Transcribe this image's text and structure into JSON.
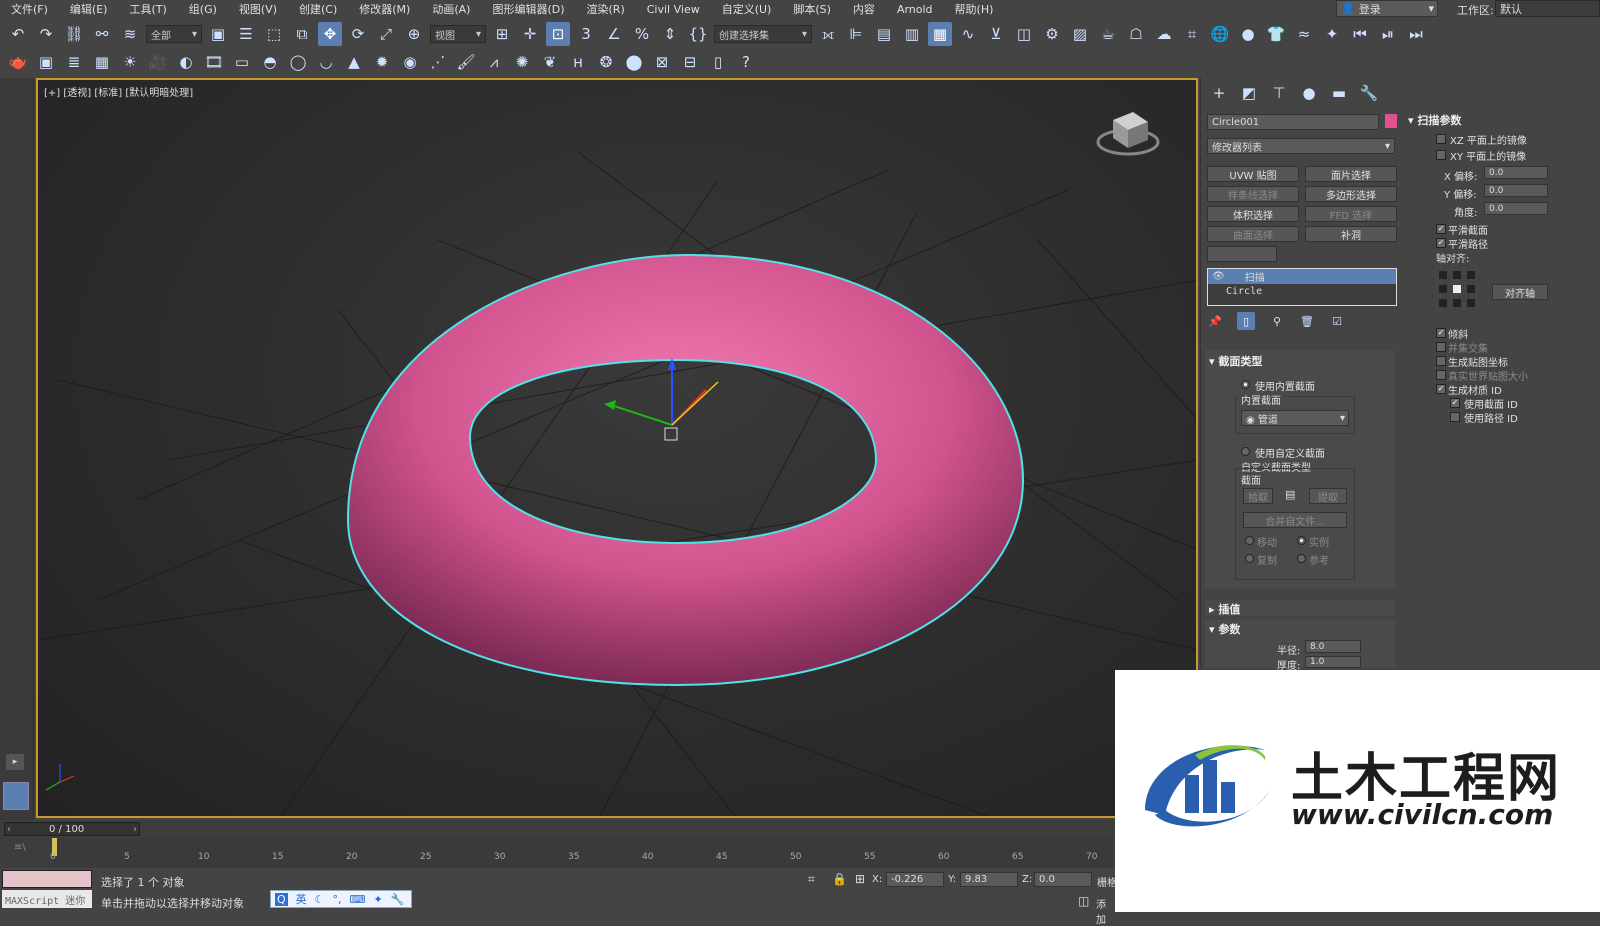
{
  "menu": [
    "文件(F)",
    "编辑(E)",
    "工具(T)",
    "组(G)",
    "视图(V)",
    "创建(C)",
    "修改器(M)",
    "动画(A)",
    "图形编辑器(D)",
    "渲染(R)",
    "Civil View",
    "自定义(U)",
    "脚本(S)",
    "内容",
    "Arnold",
    "帮助(H)"
  ],
  "login": "登录",
  "workspace_label": "工作区:",
  "workspace_value": "默认",
  "toolbar1": {
    "filter": "全部",
    "coord": "视图",
    "selset": "创建选择集"
  },
  "viewport": {
    "label": "[+] [透视] [标准] [默认明暗处理]",
    "torus_color": "#d2548f",
    "outline_color": "#4fe3e8"
  },
  "cmdpanel": {
    "object_name": "Circle001",
    "object_color": "#e0528f",
    "modifier_list": "修改器列表",
    "buttons": [
      {
        "label": "UVW 贴图",
        "enabled": true
      },
      {
        "label": "面片选择",
        "enabled": true
      },
      {
        "label": "样条线选择",
        "enabled": false
      },
      {
        "label": "多边形选择",
        "enabled": true
      },
      {
        "label": "体积选择",
        "enabled": true
      },
      {
        "label": "FFD 选择",
        "enabled": false
      },
      {
        "label": "曲面选择",
        "enabled": false
      },
      {
        "label": "补洞",
        "enabled": true
      }
    ],
    "stack": [
      "扫描",
      "Circle"
    ],
    "section_type": {
      "title": "截面类型",
      "use_builtin": "使用内置截面",
      "builtin_label": "内置截面",
      "builtin_value": "管道",
      "use_custom": "使用自定义截面",
      "custom_type": "自定义截面类型",
      "section": "截面",
      "pick": "拾取",
      "extract": "提取",
      "merge": "合并自文件...",
      "move": "移动",
      "instance": "实例",
      "copy": "复制",
      "reference": "参考"
    },
    "interp": "插值",
    "params": {
      "title": "参数",
      "radius_label": "半径:",
      "radius": "8.0",
      "thickness_label": "厚度:",
      "thickness": "1.0"
    }
  },
  "sweep_params": {
    "title": "扫描参数",
    "mirror_xz": "XZ 平面上的镜像",
    "mirror_xy": "XY 平面上的镜像",
    "x_offset_label": "X 偏移:",
    "x_offset": "0.0",
    "y_offset_label": "Y 偏移:",
    "y_offset": "0.0",
    "angle_label": "角度:",
    "angle": "0.0",
    "smooth_section": "平滑截面",
    "smooth_path": "平滑路径",
    "pivot_align": "轴对齐:",
    "align_pivot": "对齐轴",
    "banking": "倾斜",
    "union": "并集交集",
    "gen_mapping": "生成贴图坐标",
    "real_world": "真实世界贴图大小",
    "gen_matid": "生成材质 ID",
    "use_section_id": "使用截面 ID",
    "use_path_id": "使用路径 ID"
  },
  "timeline": {
    "frame": "0 / 100",
    "ticks": [
      "0",
      "5",
      "10",
      "15",
      "20",
      "25",
      "30",
      "35",
      "40",
      "45",
      "50",
      "55",
      "60",
      "65",
      "70"
    ]
  },
  "status": {
    "maxscript": "MAXScript 迷你",
    "selected": "选择了 1 个 对象",
    "hint": "单击并拖动以选择并移动对象",
    "x_label": "X:",
    "x": "-0.226",
    "y_label": "Y:",
    "y": "9.83",
    "z_label": "Z:",
    "z": "0.0",
    "grid": "栅格",
    "add": "添加"
  },
  "ime": "英",
  "watermark": {
    "title": "土木工程网",
    "url": "www.civilcn.com"
  }
}
